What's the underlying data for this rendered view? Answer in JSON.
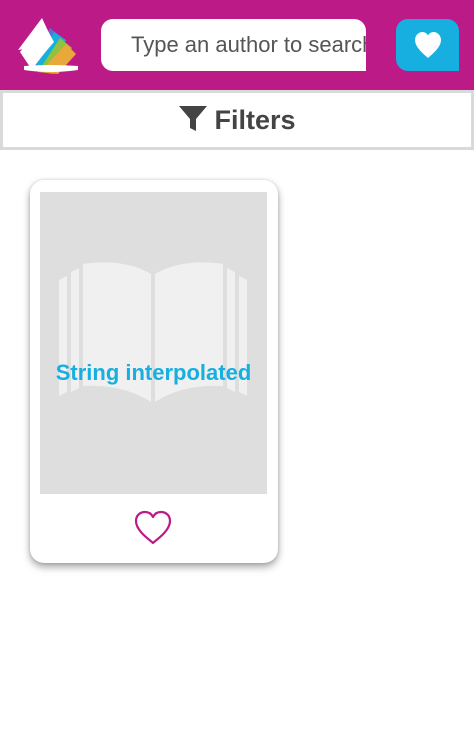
{
  "header": {
    "logo_icon": "books-logo-icon",
    "search": {
      "placeholder": "Type an author to search",
      "value": ""
    },
    "favorites_icon": "heart-icon",
    "colors": {
      "header_bg": "#bc1a87",
      "accent": "#17aee0"
    }
  },
  "filters": {
    "icon": "filter-icon",
    "label": "Filters"
  },
  "results": [
    {
      "cover_icon": "open-book-icon",
      "cover_text": "String interpolated",
      "favorite_icon": "heart-outline-icon"
    }
  ]
}
